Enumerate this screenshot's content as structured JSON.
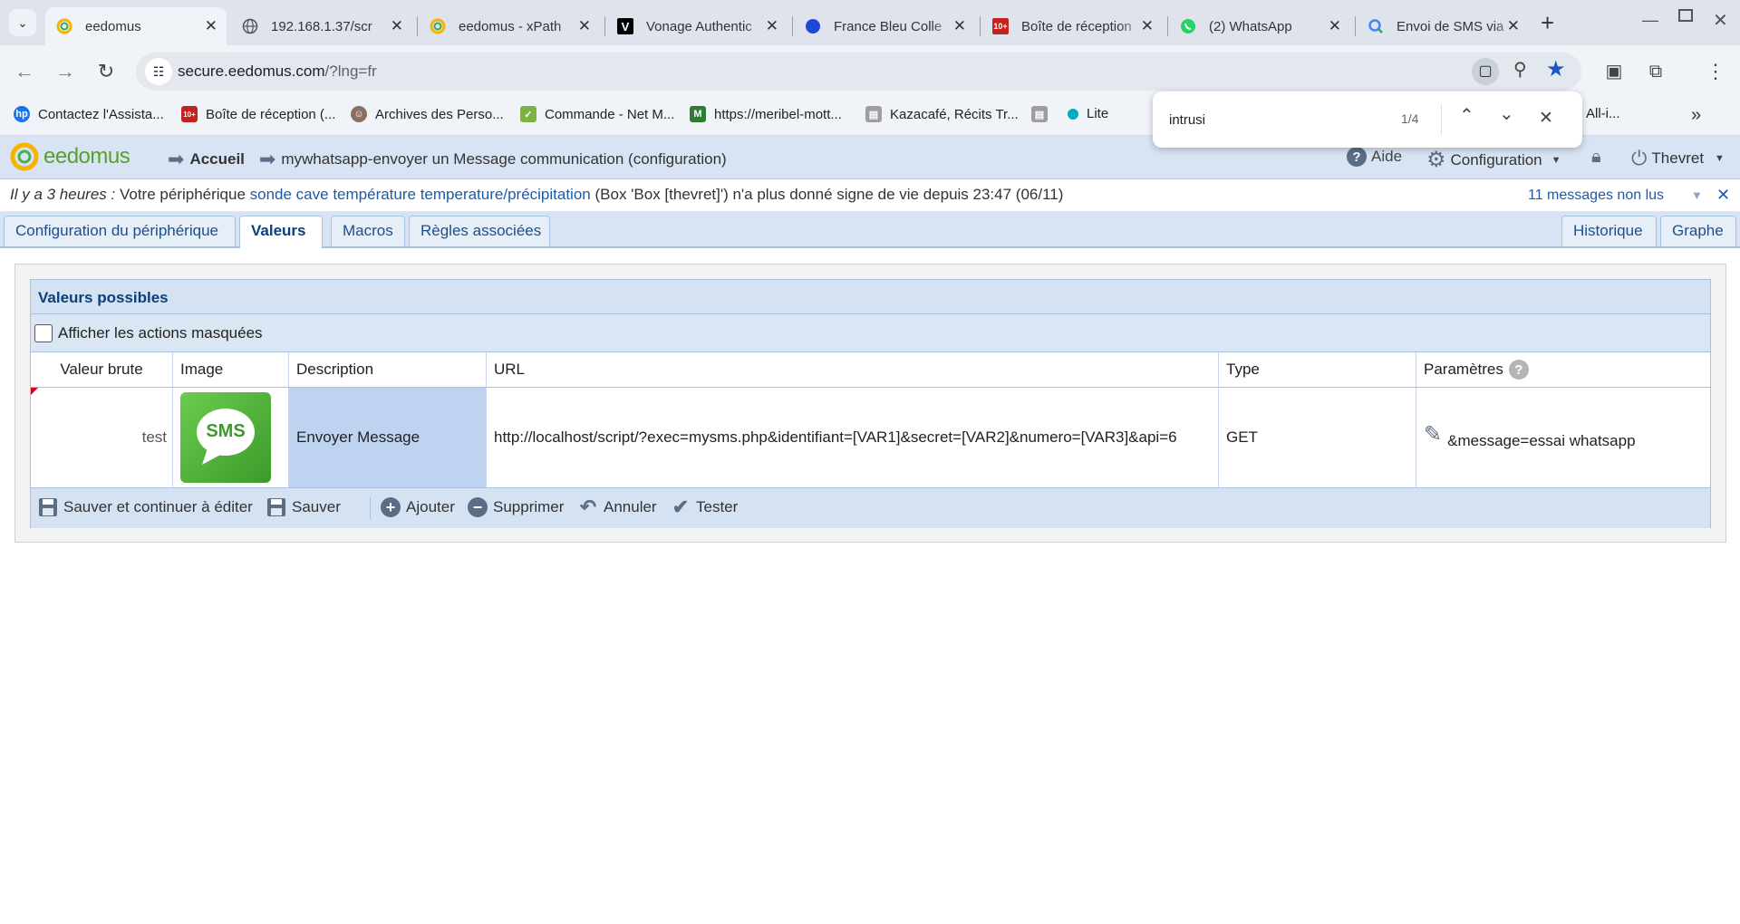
{
  "browser": {
    "tabs": [
      {
        "title": "eedomus",
        "icon": "eedomus-icon",
        "active": true
      },
      {
        "title": "192.168.1.37/scr",
        "icon": "globe-icon"
      },
      {
        "title": "eedomus - xPath",
        "icon": "eedomus-icon"
      },
      {
        "title": "Vonage Authentic",
        "icon": "vonage-icon"
      },
      {
        "title": "France Bleu Colle",
        "icon": "france-bleu-icon"
      },
      {
        "title": "Boîte de réception",
        "icon": "mail-icon"
      },
      {
        "title": "(2) WhatsApp",
        "icon": "whatsapp-icon"
      },
      {
        "title": "Envoi de SMS via",
        "icon": "search-icon"
      }
    ],
    "url_host": "secure.eedomus.com",
    "url_path": "/?lng=fr",
    "bookmarks": [
      {
        "label": "Contactez l'Assista...",
        "color": "#1a73e8"
      },
      {
        "label": "Boîte de réception (...",
        "color": "#c5221f"
      },
      {
        "label": "Archives des Perso...",
        "color": "#8d6e63"
      },
      {
        "label": "Commande - Net M...",
        "color": "#7cb342"
      },
      {
        "label": "https://meribel-mott...",
        "color": "#2e7d32"
      },
      {
        "label": "Kazacafé, Récits Tr...",
        "color": "#757575"
      },
      {
        "label": "Lite",
        "color": "#00acc1"
      },
      {
        "label": "All-i...",
        "color": "#f9a825"
      }
    ],
    "find": {
      "query": "intrusi",
      "count": "1/4"
    }
  },
  "app": {
    "logo": "eedomus",
    "breadcrumb_home": "Accueil",
    "breadcrumb_current": "mywhatsapp-envoyer un Message communication (configuration)",
    "help": "Aide",
    "config": "Configuration",
    "user": "Thevret",
    "notif_time": "Il y a 3 heures :",
    "notif_text1": "Votre périphérique",
    "notif_link": "sonde cave température temperature/précipitation",
    "notif_text2": "(Box 'Box [thevret]') n'a plus donné signe de vie depuis 23:47 (06/11)",
    "notif_unread": "11 messages non lus",
    "tabs": [
      "Configuration du périphérique",
      "Valeurs",
      "Macros",
      "Règles associées"
    ],
    "right_tabs": [
      "Historique",
      "Graphe"
    ],
    "panel_title": "Valeurs possibles",
    "show_hidden": "Afficher les actions masquées",
    "columns": [
      "Valeur brute",
      "Image",
      "Description",
      "URL",
      "Type",
      "Paramètres"
    ],
    "row": {
      "raw": "test",
      "image_text": "SMS",
      "description": "Envoyer Message",
      "url": "http://localhost/script/?exec=mysms.php&identifiant=[VAR1]&secret=[VAR2]&numero=[VAR3]&api=6",
      "type": "GET",
      "params": "&message=essai whatsapp"
    },
    "actions": [
      "Sauver et continuer à éditer",
      "Sauver",
      "Ajouter",
      "Supprimer",
      "Annuler",
      "Tester"
    ]
  }
}
